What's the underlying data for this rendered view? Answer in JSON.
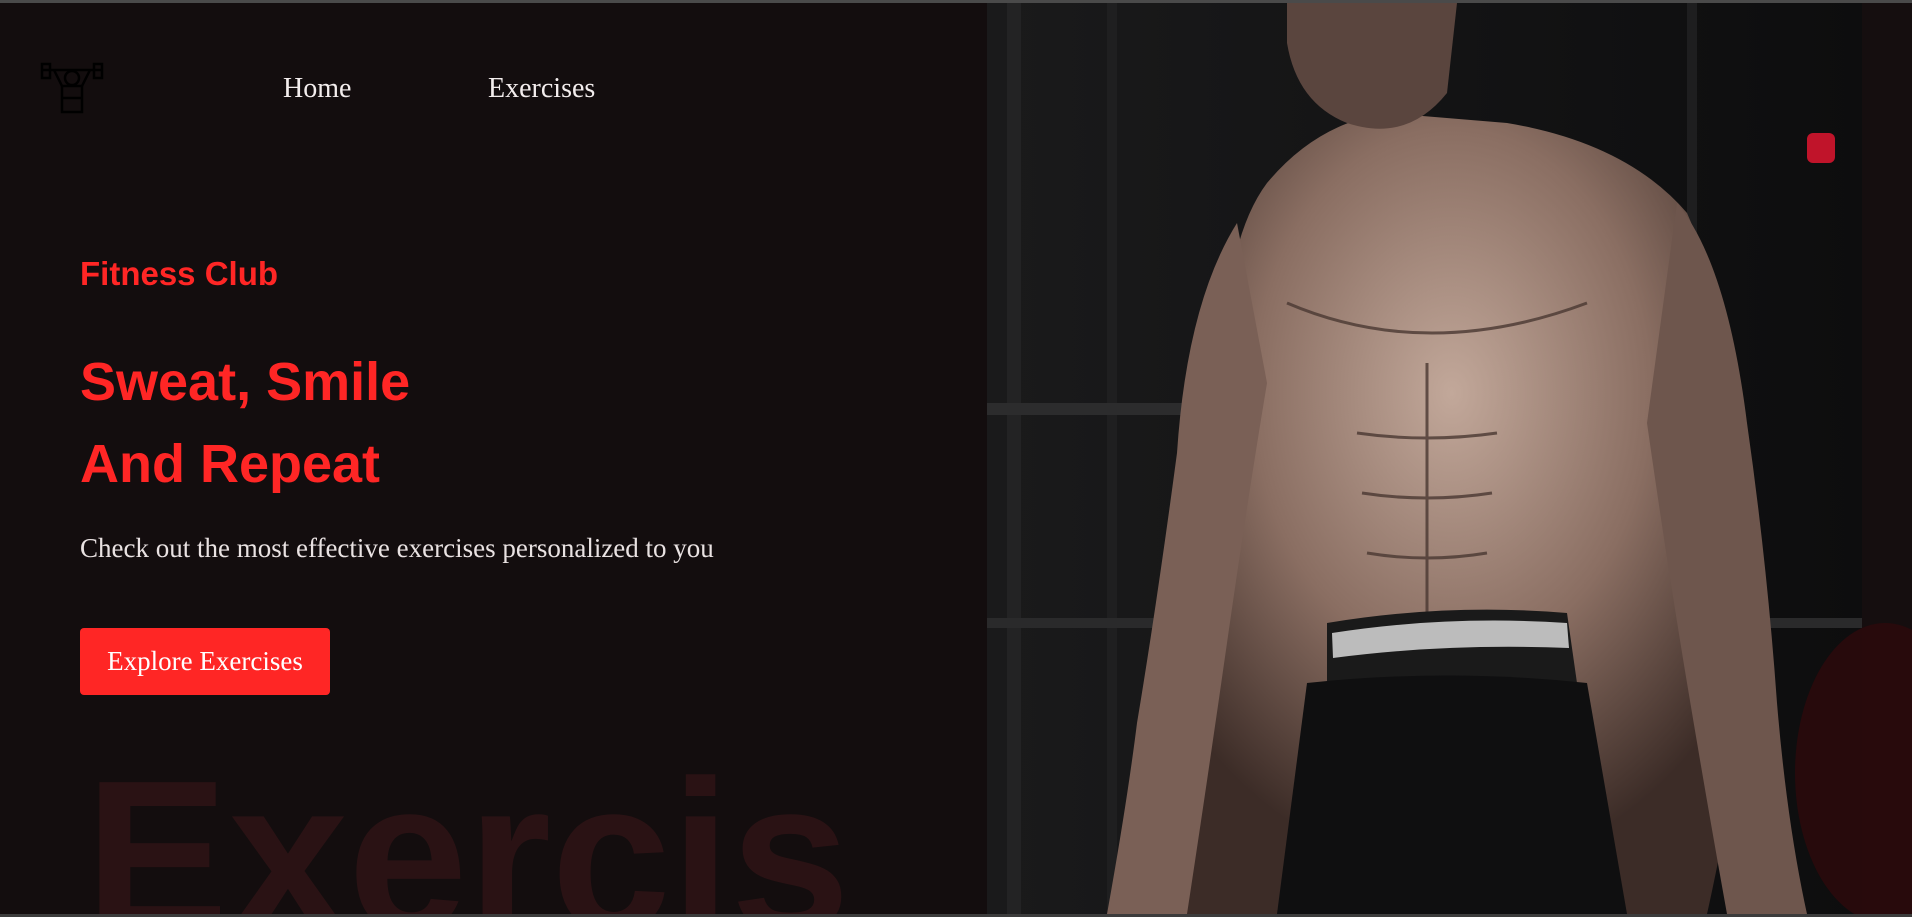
{
  "nav": {
    "logo_icon": "weightlifter-icon",
    "home_label": "Home",
    "exercises_label": "Exercises"
  },
  "hero": {
    "kicker": "Fitness Club",
    "headline_line1": "Sweat, Smile",
    "headline_line2": "And Repeat",
    "subtitle": "Check out the most effective exercises personalized to you",
    "cta_label": "Explore Exercises",
    "watermark": "Exercis",
    "image_icon": "muscular-man-photo"
  },
  "colors": {
    "accent": "#ff2625",
    "background": "#130d0e",
    "text_light": "#f3eded"
  }
}
